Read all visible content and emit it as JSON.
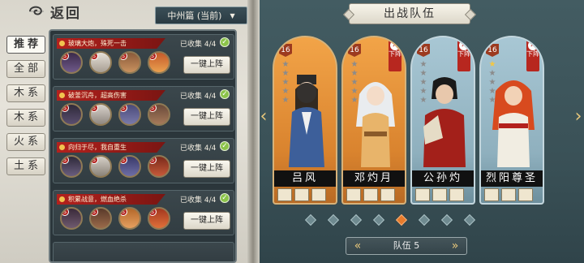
{
  "header": {
    "back_label": "返回",
    "region": "中州篇 (当前)"
  },
  "tabs": [
    "推荐",
    "全部",
    "木系",
    "木系",
    "火系",
    "土系"
  ],
  "sets": [
    {
      "title": "玻璃大炮，殊死一击",
      "collected": "已收集 4/4",
      "button": "一键上阵"
    },
    {
      "title": "破釜沉舟，超高伤害",
      "collected": "已收集 4/4",
      "button": "一键上阵"
    },
    {
      "title": "向归于尽，我自重生",
      "collected": "已收集 4/4",
      "button": "一键上阵"
    },
    {
      "title": "积累战意，燃血绝杀",
      "collected": "已收集 4/4",
      "button": "一键上阵"
    }
  ],
  "team": {
    "title": "出战队伍",
    "team_label": "队伍 5",
    "remove_label": "下阵",
    "heroes": [
      {
        "name": "吕风",
        "level": "16",
        "stars": 0,
        "removable": false,
        "theme": "orange"
      },
      {
        "name": "邓灼月",
        "level": "16",
        "stars": 0,
        "removable": true,
        "theme": "orange"
      },
      {
        "name": "公孙灼",
        "level": "16",
        "stars": 0,
        "removable": true,
        "theme": "blue"
      },
      {
        "name": "烈阳尊圣",
        "level": "16",
        "stars": 1,
        "removable": true,
        "theme": "blue"
      }
    ],
    "page_dots": 8,
    "active_dot": 4
  },
  "colors": {
    "accent_red": "#b3211d",
    "panel_teal": "#435c62",
    "gold": "#e7c77b"
  }
}
